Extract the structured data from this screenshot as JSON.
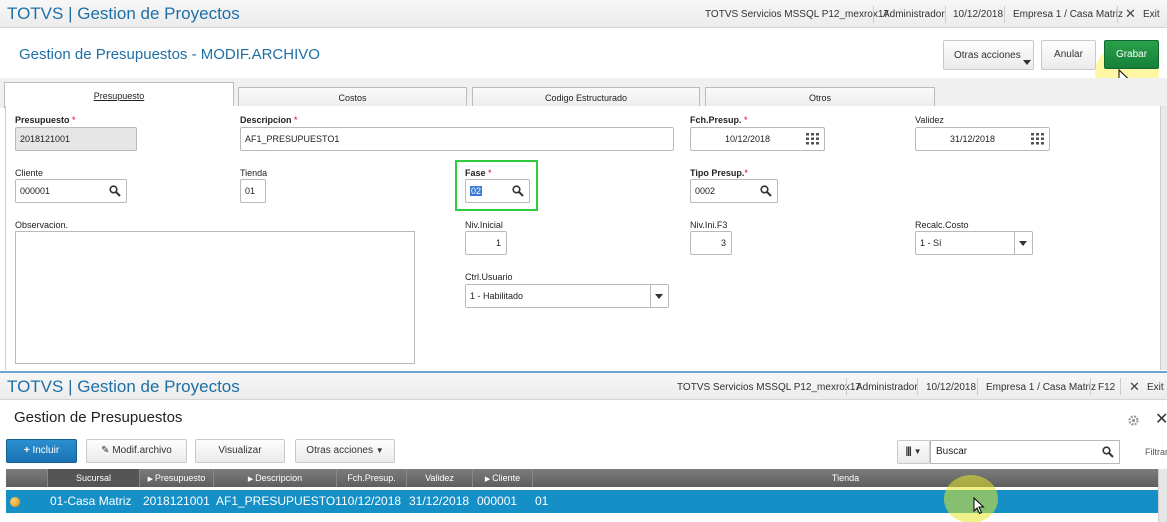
{
  "top": {
    "app_title": "TOTVS | Gestion de Proyectos",
    "server": "TOTVS Servicios MSSQL P12_mexrox17",
    "user": "Administrador",
    "date": "10/12/2018",
    "company": "Empresa 1 / Casa Matriz",
    "exit": "Exit",
    "f12": "F12"
  },
  "form": {
    "title": "Gestion de Presupuestos - MODIF.ARCHIVO",
    "buttons": {
      "other": "Otras acciones",
      "cancel": "Anular",
      "save": "Grabar"
    },
    "tabs": [
      "Presupuesto",
      "Costos",
      "Codigo Estructurado",
      "Otros"
    ],
    "fields": {
      "presupuesto": {
        "label": "Presupuesto",
        "value": "2018121001"
      },
      "descripcion": {
        "label": "Descripcion",
        "value": "AF1_PRESUPUESTO1"
      },
      "fch_presup": {
        "label": "Fch.Presup.",
        "value": "10/12/2018"
      },
      "validez": {
        "label": "Validez",
        "value": "31/12/2018"
      },
      "cliente": {
        "label": "Cliente",
        "value": "000001"
      },
      "tienda": {
        "label": "Tienda",
        "value": "01"
      },
      "fase": {
        "label": "Fase",
        "value": "02"
      },
      "tipo_presup": {
        "label": "Tipo Presup.",
        "value": "0002"
      },
      "observacion": {
        "label": "Observacion.",
        "value": ""
      },
      "niv_inicial": {
        "label": "Niv.Inicial",
        "value": "1"
      },
      "niv_ini_f3": {
        "label": "Niv.Ini.F3",
        "value": "3"
      },
      "recalc_costo": {
        "label": "Recalc.Costo",
        "value": "1 - Sí"
      },
      "ctrl_usuario": {
        "label": "Ctrl.Usuario",
        "value": "1 - Habilitado"
      }
    }
  },
  "browse": {
    "title": "Gestion de Presupuestos",
    "buttons": {
      "include": "Incluir",
      "modify": "Modif.archivo",
      "view": "Visualizar",
      "other": "Otras acciones"
    },
    "search_placeholder": "Buscar",
    "filter": "Filtrar",
    "columns": [
      "Sucursal",
      "Presupuesto",
      "Descripcion",
      "Fch.Presup.",
      "Validez",
      "Cliente",
      "Tienda"
    ],
    "row": [
      "01-Casa Matriz",
      "2018121001",
      "AF1_PRESUPUESTO1",
      "10/12/2018",
      "31/12/2018",
      "000001",
      "01"
    ]
  },
  "colors": {
    "accent": "#1d6fa5",
    "save": "#1a8a3f",
    "highlight": "#2ecc40",
    "selected_row": "#1590c7"
  }
}
